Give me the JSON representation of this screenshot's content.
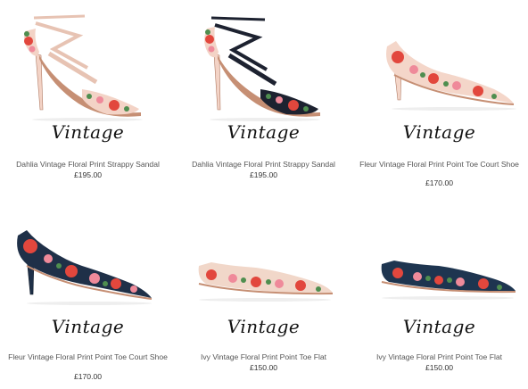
{
  "products": [
    {
      "name": "Dahlia Vintage Floral Print Strappy Sandal",
      "price": "£195.00",
      "logo": "Vintage",
      "style": "sandal",
      "base": "#f3d3c6",
      "strap": "#e7c3b3"
    },
    {
      "name": "Dahlia Vintage Floral Print Strappy Sandal",
      "price": "£195.00",
      "logo": "Vintage",
      "style": "sandal",
      "base": "#f3d3c6",
      "strap": "#1d2230"
    },
    {
      "name": "Fleur Vintage Floral Print Point Toe Court Shoe",
      "price": "£170.00",
      "logo": "Vintage",
      "style": "pump",
      "base": "#f4d6c9"
    },
    {
      "name": "Fleur Vintage Floral Print Point Toe Court Shoe",
      "price": "£170.00",
      "logo": "Vintage",
      "style": "pump",
      "base": "#1f3048"
    },
    {
      "name": "Ivy Vintage Floral Print Point Toe Flat",
      "price": "£150.00",
      "logo": "Vintage",
      "style": "flat",
      "base": "#f1d7c9"
    },
    {
      "name": "Ivy Vintage Floral Print Point Toe Flat",
      "price": "£150.00",
      "logo": "Vintage",
      "style": "flat",
      "base": "#1e3550"
    }
  ],
  "colors": {
    "flower_red": "#e2473d",
    "flower_pink": "#ef8a9a",
    "leaf_green": "#4f8e4f",
    "sole": "#c68f74"
  }
}
